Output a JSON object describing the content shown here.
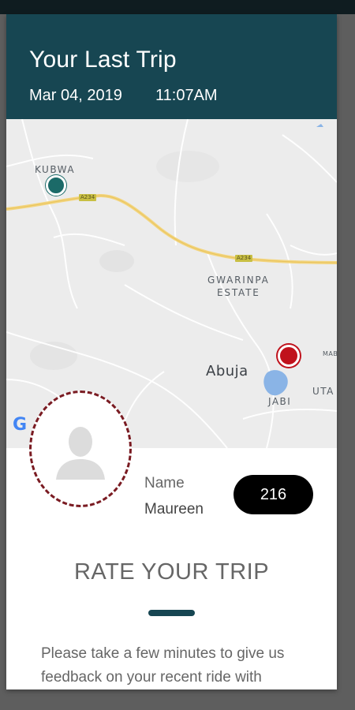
{
  "header": {
    "title": "Your Last Trip",
    "date": "Mar 04, 2019",
    "time": "11:07AM"
  },
  "map": {
    "labels": {
      "kubwa": "KUBWA",
      "gwarinpa_line1": "GWARINPA",
      "gwarinpa_line2": "ESTATE",
      "abuja": "Abuja",
      "jabi": "JABI",
      "uta": "UTA",
      "mab": "MAB"
    },
    "road_shields": [
      "A234",
      "A234"
    ],
    "google_logo": "G",
    "start_pin_color": "#1b6a68",
    "end_pin_color": "#c0121c"
  },
  "driver": {
    "avatar_icon": "person-placeholder-icon",
    "name_label": "Name",
    "name": "Maureen",
    "count": "216"
  },
  "rating": {
    "title": "RATE YOUR TRIP",
    "feedback_text": "Please take a few minutes to give us feedback on your recent ride with"
  },
  "colors": {
    "header_bg": "#174652",
    "accent_dark": "#7a1b22",
    "badge_bg": "#000000"
  }
}
